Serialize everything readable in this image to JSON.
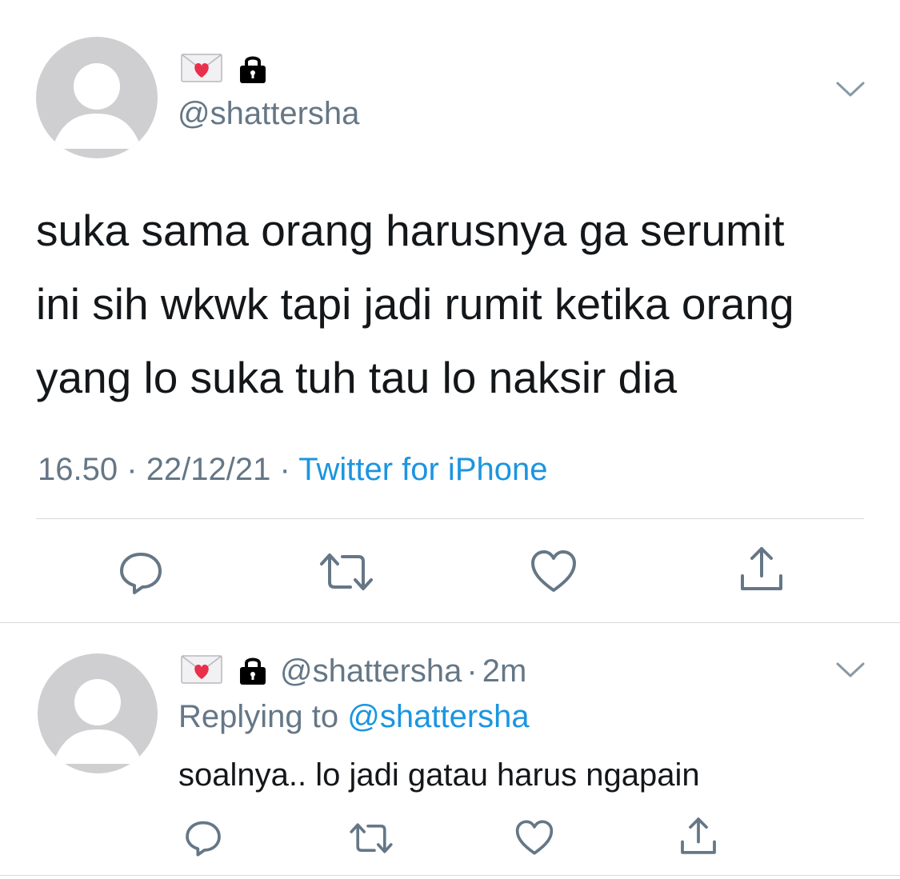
{
  "main_tweet": {
    "display_name_icons": [
      "love-letter-icon",
      "lock-icon"
    ],
    "handle": "@shattersha",
    "text_lines": [
      "suka sama orang harusnya ga serumit",
      "ini sih wkwk tapi jadi rumit ketika orang",
      "yang lo suka tuh tau lo naksir dia"
    ],
    "time": "16.50",
    "date": "22/12/21",
    "separator": "·",
    "source": "Twitter for iPhone"
  },
  "reply_tweet": {
    "display_name_icons": [
      "love-letter-icon",
      "lock-icon"
    ],
    "handle": "@shattersha",
    "separator": "·",
    "time_ago": "2m",
    "replying_to_prefix": "Replying to",
    "replying_to_handle": "@shattersha",
    "text": "soalnya.. lo jadi gatau harus ngapain"
  },
  "actions": [
    "reply-icon",
    "retweet-icon",
    "like-icon",
    "share-icon"
  ],
  "colors": {
    "text": "#14171a",
    "secondary": "#657786",
    "link": "#1b95e0",
    "icon": "#657786",
    "avatar_bg": "#cfcfd1",
    "divider": "#d9d9d9"
  }
}
